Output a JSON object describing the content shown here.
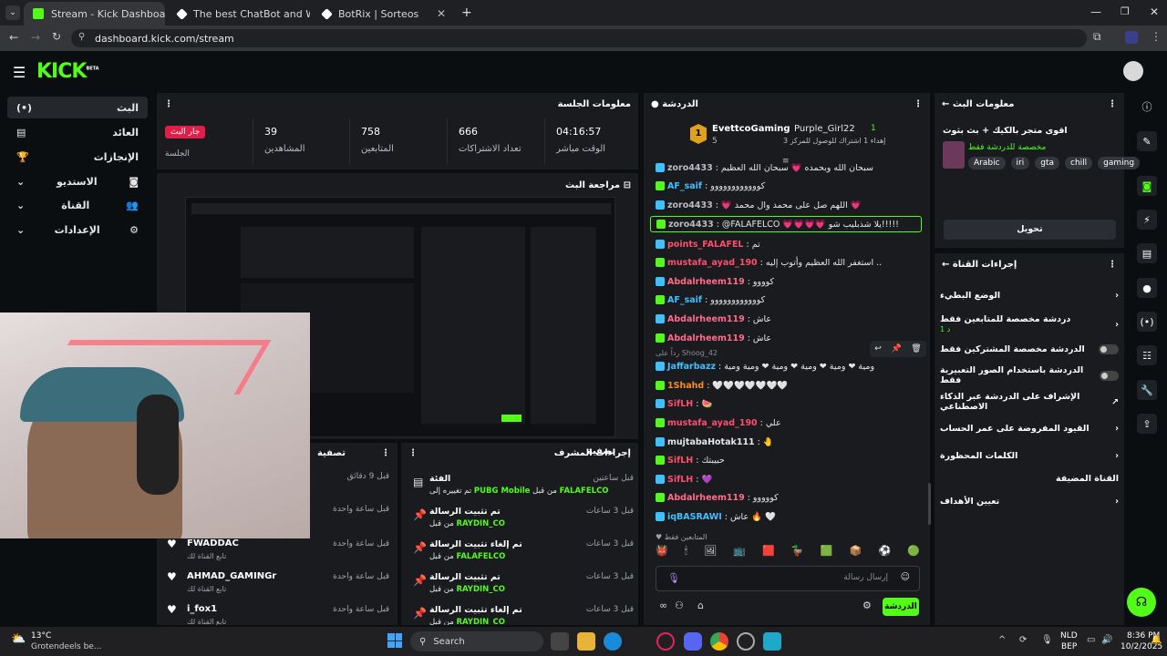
{
  "browser": {
    "tabs": [
      {
        "title": "Stream - Kick Dashboard",
        "active": true
      },
      {
        "title": "The best ChatBot and Widgets"
      },
      {
        "title": "BotRix | Sorteos"
      }
    ],
    "url": "dashboard.kick.com/stream"
  },
  "kick": {
    "logo": "KICK",
    "logo_sup": "BETA",
    "sidebar": [
      {
        "label": "البث",
        "icon": "(•)"
      },
      {
        "label": "العائد",
        "icon": "▤"
      },
      {
        "label": "الإنجازات",
        "icon": "🏆"
      },
      {
        "label": "الاستديو",
        "icon": "◙"
      },
      {
        "label": "القناة",
        "icon": "👥"
      },
      {
        "label": "الإعدادات",
        "icon": "⚙"
      }
    ]
  },
  "session": {
    "title": "معلومات الجلسة",
    "live_badge": "جار البث",
    "live_label": "الجلسة",
    "stats": [
      {
        "value": "39",
        "label": "المشاهدين"
      },
      {
        "value": "758",
        "label": "المتابعين"
      },
      {
        "value": "666",
        "label": "تعداد الاشتراكات"
      },
      {
        "value": "04:16:57",
        "label": "الوقت مباشر"
      }
    ]
  },
  "preview": {
    "title": "مراجعة البث"
  },
  "feed": {
    "title": "تصفية",
    "items": [
      {
        "time": "قبل 9 دقائق",
        "name": "",
        "sub": ""
      },
      {
        "time": "قبل ساعة واحدة",
        "name": "",
        "sub": ""
      },
      {
        "time": "قبل ساعة واحدة",
        "name": "FWADDAC",
        "sub": "تابع القناة لك"
      },
      {
        "time": "قبل ساعة واحدة",
        "name": "AHMAD_GAMINGr",
        "sub": "تابع القناة لك"
      },
      {
        "time": "قبل ساعة واحدة",
        "name": "i_fox1",
        "sub": "تابع القناة لك"
      }
    ]
  },
  "mod": {
    "title": "إجراءات المشرف",
    "filter": "تصفية",
    "items": [
      {
        "time": "قبل ساعتين",
        "title": "الفئة",
        "sub_prefix": "تم تغييره إلى",
        "highlight": "PUBG Mobile",
        "sub_suffix": "من قبل",
        "user": "FALAFELCO",
        "icon": "▤"
      },
      {
        "time": "قبل 3 ساعات",
        "title": "تم تثبيت الرسالة",
        "sub_prefix": "",
        "highlight": "",
        "sub_suffix": "من قبل",
        "user": "RAYDIN_CO",
        "icon": "📌"
      },
      {
        "time": "قبل 3 ساعات",
        "title": "تم إلغاء تثبيت الرسالة",
        "sub_prefix": "",
        "highlight": "",
        "sub_suffix": "من قبل",
        "user": "FALAFELCO",
        "icon": "📌"
      },
      {
        "time": "قبل 3 ساعات",
        "title": "تم تثبيت الرسالة",
        "sub_prefix": "",
        "highlight": "",
        "sub_suffix": "من قبل",
        "user": "RAYDIN_CO",
        "icon": "📌"
      },
      {
        "time": "قبل 3 ساعات",
        "title": "تم إلغاء تثبيت الرسالة",
        "sub_prefix": "",
        "highlight": "",
        "sub_suffix": "من قبل",
        "user": "RAYDIN_CO",
        "icon": "📌"
      }
    ]
  },
  "chat": {
    "title": "الدردشة",
    "leaderboard": {
      "first": "EvettcoGaming",
      "first_pts": "5",
      "second": "Purple_Girl22",
      "second_pts": "1",
      "second_sub": "إهداء 1 اشتراك للوصول للمركز 3"
    },
    "messages": [
      {
        "user": "zoro4433",
        "color": "#b9bcc2",
        "text": "سبحان الله وبحمده 💗 سبحان الله العظيم"
      },
      {
        "user": "AF_saif",
        "color": "#3ec1ff",
        "text": "كوووووووووووو"
      },
      {
        "user": "zoro4433",
        "color": "#b9bcc2",
        "text": "💗 اللهم صل على محمد وال محمد 💗"
      },
      {
        "user": "zoro4433",
        "color": "#b9bcc2",
        "text": "@FALAFELCO 💗💗💗💗 يلا شذبليب شو!!!!!",
        "pinned": true
      },
      {
        "user": "points_FALAFEL",
        "color": "#ff4d6d",
        "text": "تم"
      },
      {
        "user": "mustafa_ayad_190",
        "color": "#ff4d6d",
        "text": "استغفر الله العظيم وأتوب إليه .."
      },
      {
        "user": "Abdalrheem119",
        "color": "#ff6b8b",
        "text": "كوووو"
      },
      {
        "user": "AF_saif",
        "color": "#3ec1ff",
        "text": "كوووووووووووو"
      },
      {
        "user": "Abdalrheem119",
        "color": "#ff6b8b",
        "text": "عاش"
      },
      {
        "user": "Abdalrheem119",
        "color": "#ff6b8b",
        "text": "عاش"
      },
      {
        "user": "Jaffarbazz",
        "color": "#3ec1ff",
        "text": "ومية ❤ ومية ❤ ومية ❤ ومية ❤ ومية ومية",
        "reply": "رداً على Shoog_42"
      },
      {
        "user": "1Shahd",
        "color": "#ff8c1a",
        "text": "🤍🤍🤍🤍🤍🤍🤍"
      },
      {
        "user": "SifLH",
        "color": "#ff4d6d",
        "text": "🍉"
      },
      {
        "user": "mustafa_ayad_190",
        "color": "#ff4d6d",
        "text": "علي"
      },
      {
        "user": "mujtabaHotak111",
        "color": "#e6e6e6",
        "text": "🤚"
      },
      {
        "user": "SifLH",
        "color": "#ff4d6d",
        "text": "حبيبتك"
      },
      {
        "user": "SifLH",
        "color": "#ff4d6d",
        "text": "💜"
      },
      {
        "user": "Abdalrheem119",
        "color": "#ff6b8b",
        "text": "كووووو"
      },
      {
        "user": "iqBASRAWI",
        "color": "#3ec1ff",
        "text": "عاش 🔥 🤍"
      }
    ],
    "followers_only": "المتابعين فقط",
    "input_placeholder": "إرسال رسالة",
    "send": "الدردشة",
    "colors": {
      "kick_green": "#53fc18"
    }
  },
  "stream_info": {
    "title": "معلومات البث",
    "stream_title": "اقوى متجر بالكيك + بث بثوث",
    "category": "مخصصة للدردشة فقط",
    "tags": [
      "Arabic",
      "iri",
      "gta",
      "chill",
      "gaming"
    ],
    "edit": "تحويل"
  },
  "channel_actions": {
    "title": "إجراءات القناة",
    "rows": [
      {
        "label": "الوضع البطيء",
        "control": "chevron"
      },
      {
        "label": "دردشة مخصصة للمتابعين فقط",
        "sub": "1 د",
        "control": "chevron"
      },
      {
        "label": "الدردشة مخصصة المشتركين فقط",
        "control": "toggle"
      },
      {
        "label": "الدردشة باستخدام الصور التعبيرية فقط",
        "control": "toggle"
      },
      {
        "label": "الإشراف على الدردشة عبر الذكاء الاصطناعي",
        "control": "external"
      },
      {
        "label": "القيود المفروضة على عمر الحساب",
        "control": "chevron"
      },
      {
        "label": "الكلمات المحظورة",
        "control": "chevron"
      },
      {
        "label": "القناة المضيفة",
        "control": "none"
      },
      {
        "label": "تعيين الأهداف",
        "control": "chevron"
      }
    ]
  },
  "taskbar": {
    "weather_temp": "13°C",
    "weather_desc": "Grotendeels be...",
    "search": "Search",
    "lang": "NLD",
    "lang2": "BEP",
    "time": "8:36 PM",
    "date": "10/2/2025"
  }
}
